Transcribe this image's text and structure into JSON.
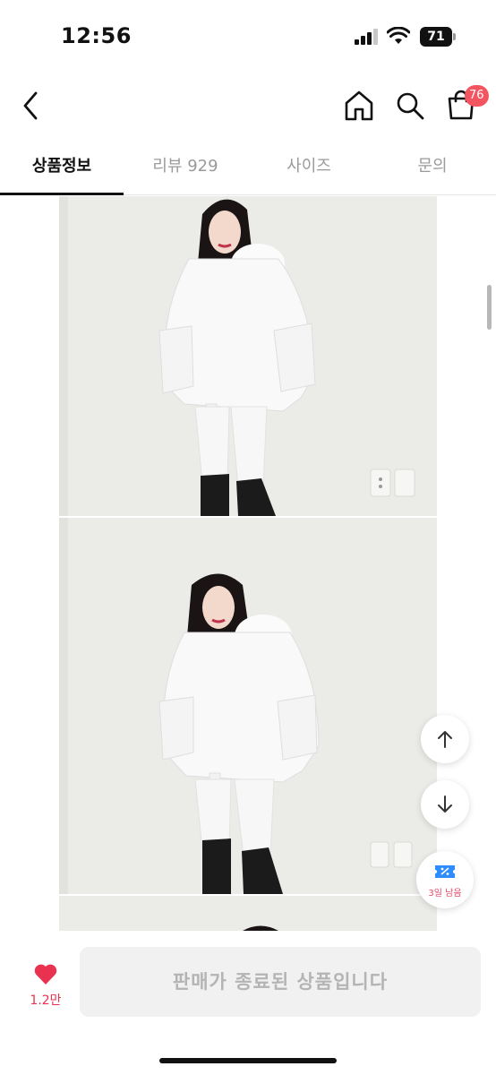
{
  "status_bar": {
    "time": "12:56",
    "battery_level": "71"
  },
  "nav": {
    "back_icon": "chevron-left-icon",
    "home_icon": "home-icon",
    "search_icon": "search-icon",
    "cart_icon": "shopping-bag-icon",
    "cart_count": "76"
  },
  "tabs": [
    {
      "label": "상품정보",
      "active": true
    },
    {
      "label": "리뷰 929",
      "active": false
    },
    {
      "label": "사이즈",
      "active": false
    },
    {
      "label": "문의",
      "active": false
    }
  ],
  "floating": {
    "scroll_up_icon": "arrow-up-icon",
    "scroll_down_icon": "arrow-down-icon",
    "coupon_icon": "coupon-icon",
    "coupon_label": "3일 남음"
  },
  "bottom_bar": {
    "like_icon": "heart-icon",
    "like_count": "1.2만",
    "status_text": "판매가 종료된 상품입니다"
  },
  "colors": {
    "accent": "#f25560",
    "heart": "#e8324f",
    "disabled_button": "#f1f1f1",
    "disabled_text": "#b4b4b4"
  }
}
